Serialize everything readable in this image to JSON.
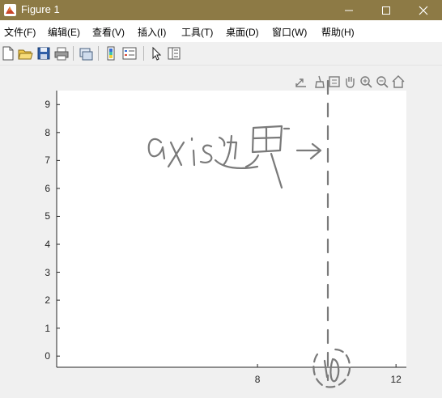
{
  "window": {
    "title": "Figure 1"
  },
  "menu": {
    "items": [
      {
        "label": "文件(F)"
      },
      {
        "label": "编辑(E)"
      },
      {
        "label": "查看(V)"
      },
      {
        "label": "插入(I)"
      },
      {
        "label": "工具(T)"
      },
      {
        "label": "桌面(D)"
      },
      {
        "label": "窗口(W)"
      },
      {
        "label": "帮助(H)"
      }
    ]
  },
  "toolbar": {
    "icons": [
      "new-figure-icon",
      "open-file-icon",
      "save-icon",
      "print-icon",
      "link-plot-icon",
      "insert-colorbar-icon",
      "insert-legend-icon",
      "edit-plot-icon",
      "property-inspector-icon"
    ]
  },
  "axes_toolbar": {
    "icons": [
      "export-icon",
      "brush-icon",
      "data-tips-icon",
      "pan-hand-icon",
      "zoom-in-icon",
      "zoom-out-icon",
      "home-icon"
    ]
  },
  "chart_data": {
    "type": "scatter",
    "ylim": [
      -0.4,
      9.5
    ],
    "xlim": [
      2.2,
      12.3
    ],
    "yticks": [
      "0",
      "1",
      "2",
      "3",
      "4",
      "5",
      "6",
      "7",
      "8",
      "9"
    ],
    "xticks": [
      "8",
      "12"
    ],
    "grid": false,
    "series": [],
    "annotations": {
      "handwritten": "axis边界→",
      "circle_note": "10"
    }
  },
  "colors": {
    "titlebar": "#8d7a45",
    "annotation": "#7a7a7a"
  }
}
